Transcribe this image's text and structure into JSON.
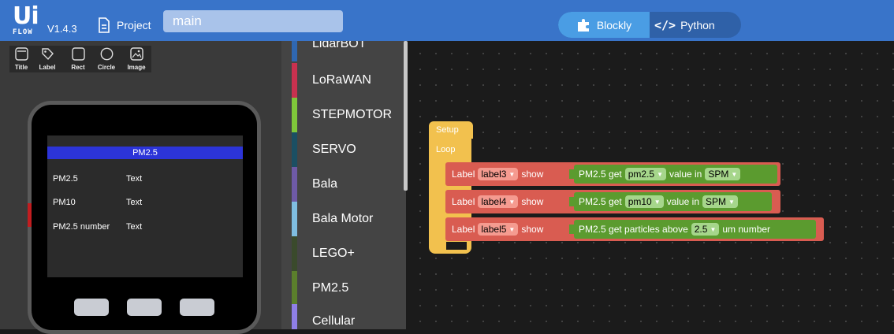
{
  "header": {
    "logo_ui": "Ui",
    "logo_flow": "FLOW",
    "version": "V1.4.3",
    "project_label": "Project",
    "filename": "main",
    "mode_blockly": "Blockly",
    "mode_python": "Python",
    "python_icon": "</>"
  },
  "colors": {
    "header_bg": "#3974c9",
    "blockly_active": "#4a9de4",
    "setup_block": "#f2c14e",
    "label_block": "#d95c51",
    "pm25_block": "#5b9b2f",
    "screen_title_bar": "#2c34d8"
  },
  "tools": [
    {
      "label": "Title",
      "icon": "title-icon"
    },
    {
      "label": "Label",
      "icon": "label-icon"
    },
    {
      "label": "Rect",
      "icon": "rect-icon"
    },
    {
      "label": "Circle",
      "icon": "circle-icon"
    },
    {
      "label": "Image",
      "icon": "image-icon"
    }
  ],
  "screen": {
    "title": "PM2.5",
    "labels": [
      {
        "name": "PM2.5",
        "value": "Text"
      },
      {
        "name": "PM10",
        "value": "Text"
      },
      {
        "name": "PM2.5 number",
        "value": "Text"
      }
    ]
  },
  "categories": [
    {
      "name": "LidarBOT",
      "color": "#2f67b1"
    },
    {
      "name": "LoRaWAN",
      "color": "#c8314f"
    },
    {
      "name": "STEPMOTOR",
      "color": "#7fc73a"
    },
    {
      "name": "SERVO",
      "color": "#1b4f63"
    },
    {
      "name": "Bala",
      "color": "#6e5aa6"
    },
    {
      "name": "Bala Motor",
      "color": "#7fbde0"
    },
    {
      "name": "LEGO+",
      "color": "#3a4a2c"
    },
    {
      "name": "PM2.5",
      "color": "#5b7f2c"
    },
    {
      "name": "Cellular",
      "color": "#8f7fe6"
    }
  ],
  "blocks": {
    "setup": "Setup",
    "loop": "Loop",
    "statements": [
      {
        "prefix": "Label",
        "label": "label3",
        "show": "show",
        "get": "PM2.5 get",
        "param": "pm2.5",
        "value_in": "value in",
        "unit": "SPM",
        "suffix": ""
      },
      {
        "prefix": "Label",
        "label": "label4",
        "show": "show",
        "get": "PM2.5 get",
        "param": "pm10",
        "value_in": "value in",
        "unit": "SPM",
        "suffix": ""
      },
      {
        "prefix": "Label",
        "label": "label5",
        "show": "show",
        "get": "PM2.5 get particles above",
        "param": "2.5",
        "value_in": "",
        "unit": "",
        "suffix": "um number"
      }
    ]
  }
}
